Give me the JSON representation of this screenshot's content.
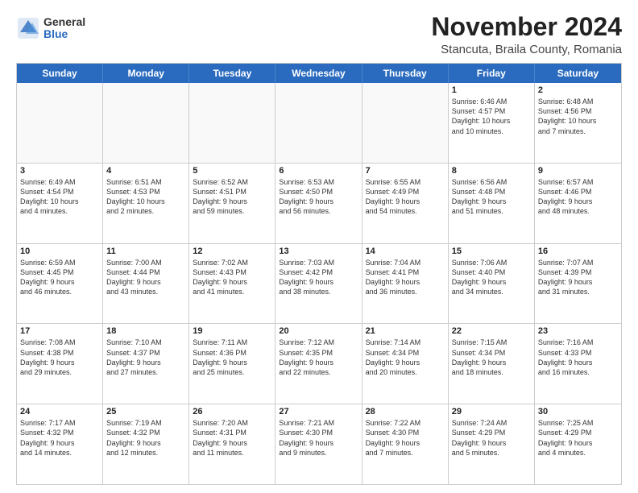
{
  "header": {
    "logo_general": "General",
    "logo_blue": "Blue",
    "main_title": "November 2024",
    "subtitle": "Stancuta, Braila County, Romania"
  },
  "calendar": {
    "days_of_week": [
      "Sunday",
      "Monday",
      "Tuesday",
      "Wednesday",
      "Thursday",
      "Friday",
      "Saturday"
    ],
    "weeks": [
      [
        {
          "day": "",
          "empty": true
        },
        {
          "day": "",
          "empty": true
        },
        {
          "day": "",
          "empty": true
        },
        {
          "day": "",
          "empty": true
        },
        {
          "day": "",
          "empty": true
        },
        {
          "day": "1",
          "lines": [
            "Sunrise: 6:46 AM",
            "Sunset: 4:57 PM",
            "Daylight: 10 hours",
            "and 10 minutes."
          ]
        },
        {
          "day": "2",
          "lines": [
            "Sunrise: 6:48 AM",
            "Sunset: 4:56 PM",
            "Daylight: 10 hours",
            "and 7 minutes."
          ]
        }
      ],
      [
        {
          "day": "3",
          "lines": [
            "Sunrise: 6:49 AM",
            "Sunset: 4:54 PM",
            "Daylight: 10 hours",
            "and 4 minutes."
          ]
        },
        {
          "day": "4",
          "lines": [
            "Sunrise: 6:51 AM",
            "Sunset: 4:53 PM",
            "Daylight: 10 hours",
            "and 2 minutes."
          ]
        },
        {
          "day": "5",
          "lines": [
            "Sunrise: 6:52 AM",
            "Sunset: 4:51 PM",
            "Daylight: 9 hours",
            "and 59 minutes."
          ]
        },
        {
          "day": "6",
          "lines": [
            "Sunrise: 6:53 AM",
            "Sunset: 4:50 PM",
            "Daylight: 9 hours",
            "and 56 minutes."
          ]
        },
        {
          "day": "7",
          "lines": [
            "Sunrise: 6:55 AM",
            "Sunset: 4:49 PM",
            "Daylight: 9 hours",
            "and 54 minutes."
          ]
        },
        {
          "day": "8",
          "lines": [
            "Sunrise: 6:56 AM",
            "Sunset: 4:48 PM",
            "Daylight: 9 hours",
            "and 51 minutes."
          ]
        },
        {
          "day": "9",
          "lines": [
            "Sunrise: 6:57 AM",
            "Sunset: 4:46 PM",
            "Daylight: 9 hours",
            "and 48 minutes."
          ]
        }
      ],
      [
        {
          "day": "10",
          "lines": [
            "Sunrise: 6:59 AM",
            "Sunset: 4:45 PM",
            "Daylight: 9 hours",
            "and 46 minutes."
          ]
        },
        {
          "day": "11",
          "lines": [
            "Sunrise: 7:00 AM",
            "Sunset: 4:44 PM",
            "Daylight: 9 hours",
            "and 43 minutes."
          ]
        },
        {
          "day": "12",
          "lines": [
            "Sunrise: 7:02 AM",
            "Sunset: 4:43 PM",
            "Daylight: 9 hours",
            "and 41 minutes."
          ]
        },
        {
          "day": "13",
          "lines": [
            "Sunrise: 7:03 AM",
            "Sunset: 4:42 PM",
            "Daylight: 9 hours",
            "and 38 minutes."
          ]
        },
        {
          "day": "14",
          "lines": [
            "Sunrise: 7:04 AM",
            "Sunset: 4:41 PM",
            "Daylight: 9 hours",
            "and 36 minutes."
          ]
        },
        {
          "day": "15",
          "lines": [
            "Sunrise: 7:06 AM",
            "Sunset: 4:40 PM",
            "Daylight: 9 hours",
            "and 34 minutes."
          ]
        },
        {
          "day": "16",
          "lines": [
            "Sunrise: 7:07 AM",
            "Sunset: 4:39 PM",
            "Daylight: 9 hours",
            "and 31 minutes."
          ]
        }
      ],
      [
        {
          "day": "17",
          "lines": [
            "Sunrise: 7:08 AM",
            "Sunset: 4:38 PM",
            "Daylight: 9 hours",
            "and 29 minutes."
          ]
        },
        {
          "day": "18",
          "lines": [
            "Sunrise: 7:10 AM",
            "Sunset: 4:37 PM",
            "Daylight: 9 hours",
            "and 27 minutes."
          ]
        },
        {
          "day": "19",
          "lines": [
            "Sunrise: 7:11 AM",
            "Sunset: 4:36 PM",
            "Daylight: 9 hours",
            "and 25 minutes."
          ]
        },
        {
          "day": "20",
          "lines": [
            "Sunrise: 7:12 AM",
            "Sunset: 4:35 PM",
            "Daylight: 9 hours",
            "and 22 minutes."
          ]
        },
        {
          "day": "21",
          "lines": [
            "Sunrise: 7:14 AM",
            "Sunset: 4:34 PM",
            "Daylight: 9 hours",
            "and 20 minutes."
          ]
        },
        {
          "day": "22",
          "lines": [
            "Sunrise: 7:15 AM",
            "Sunset: 4:34 PM",
            "Daylight: 9 hours",
            "and 18 minutes."
          ]
        },
        {
          "day": "23",
          "lines": [
            "Sunrise: 7:16 AM",
            "Sunset: 4:33 PM",
            "Daylight: 9 hours",
            "and 16 minutes."
          ]
        }
      ],
      [
        {
          "day": "24",
          "lines": [
            "Sunrise: 7:17 AM",
            "Sunset: 4:32 PM",
            "Daylight: 9 hours",
            "and 14 minutes."
          ]
        },
        {
          "day": "25",
          "lines": [
            "Sunrise: 7:19 AM",
            "Sunset: 4:32 PM",
            "Daylight: 9 hours",
            "and 12 minutes."
          ]
        },
        {
          "day": "26",
          "lines": [
            "Sunrise: 7:20 AM",
            "Sunset: 4:31 PM",
            "Daylight: 9 hours",
            "and 11 minutes."
          ]
        },
        {
          "day": "27",
          "lines": [
            "Sunrise: 7:21 AM",
            "Sunset: 4:30 PM",
            "Daylight: 9 hours",
            "and 9 minutes."
          ]
        },
        {
          "day": "28",
          "lines": [
            "Sunrise: 7:22 AM",
            "Sunset: 4:30 PM",
            "Daylight: 9 hours",
            "and 7 minutes."
          ]
        },
        {
          "day": "29",
          "lines": [
            "Sunrise: 7:24 AM",
            "Sunset: 4:29 PM",
            "Daylight: 9 hours",
            "and 5 minutes."
          ]
        },
        {
          "day": "30",
          "lines": [
            "Sunrise: 7:25 AM",
            "Sunset: 4:29 PM",
            "Daylight: 9 hours",
            "and 4 minutes."
          ]
        }
      ]
    ]
  }
}
